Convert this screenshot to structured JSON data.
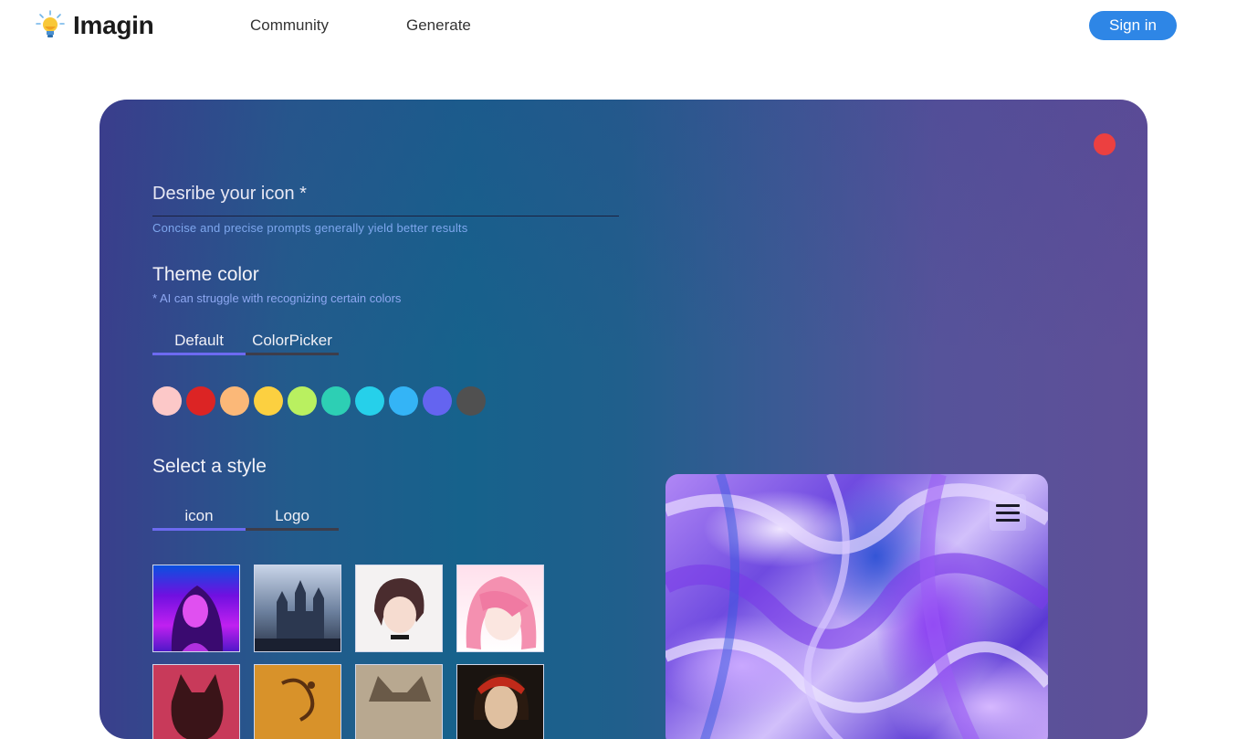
{
  "nav": {
    "logo_text": "Imagin",
    "links": [
      "Community",
      "Generate"
    ],
    "signin_label": "Sign in"
  },
  "form": {
    "prompt_label": "Desribe your icon *",
    "prompt_hint": "Concise and precise prompts generally yield better results",
    "theme_title": "Theme color",
    "theme_hint": "* AI can struggle with recognizing certain colors",
    "color_tabs": [
      "Default",
      "ColorPicker"
    ],
    "swatches": [
      "#fcc8c8",
      "#dc2424",
      "#fbb878",
      "#fcd040",
      "#b9f060",
      "#2dcfb4",
      "#26d0ea",
      "#34b4f6",
      "#6464f0",
      "#505050"
    ],
    "style_title": "Select a style",
    "style_tabs": [
      "icon",
      "Logo"
    ],
    "thumbnails": [
      "neon-portrait",
      "gothic-castle",
      "anime-girl-bob",
      "pink-hair-anime",
      "red-cat",
      "golden-pattern",
      "tabby-cat",
      "classic-portrait"
    ]
  },
  "colors": {
    "accent": "#6d6af0",
    "signin": "#2e86e6",
    "close_dot": "#ec4040"
  },
  "icons": {
    "logo": "lightbulb-icon",
    "menu": "hamburger-menu-icon"
  }
}
